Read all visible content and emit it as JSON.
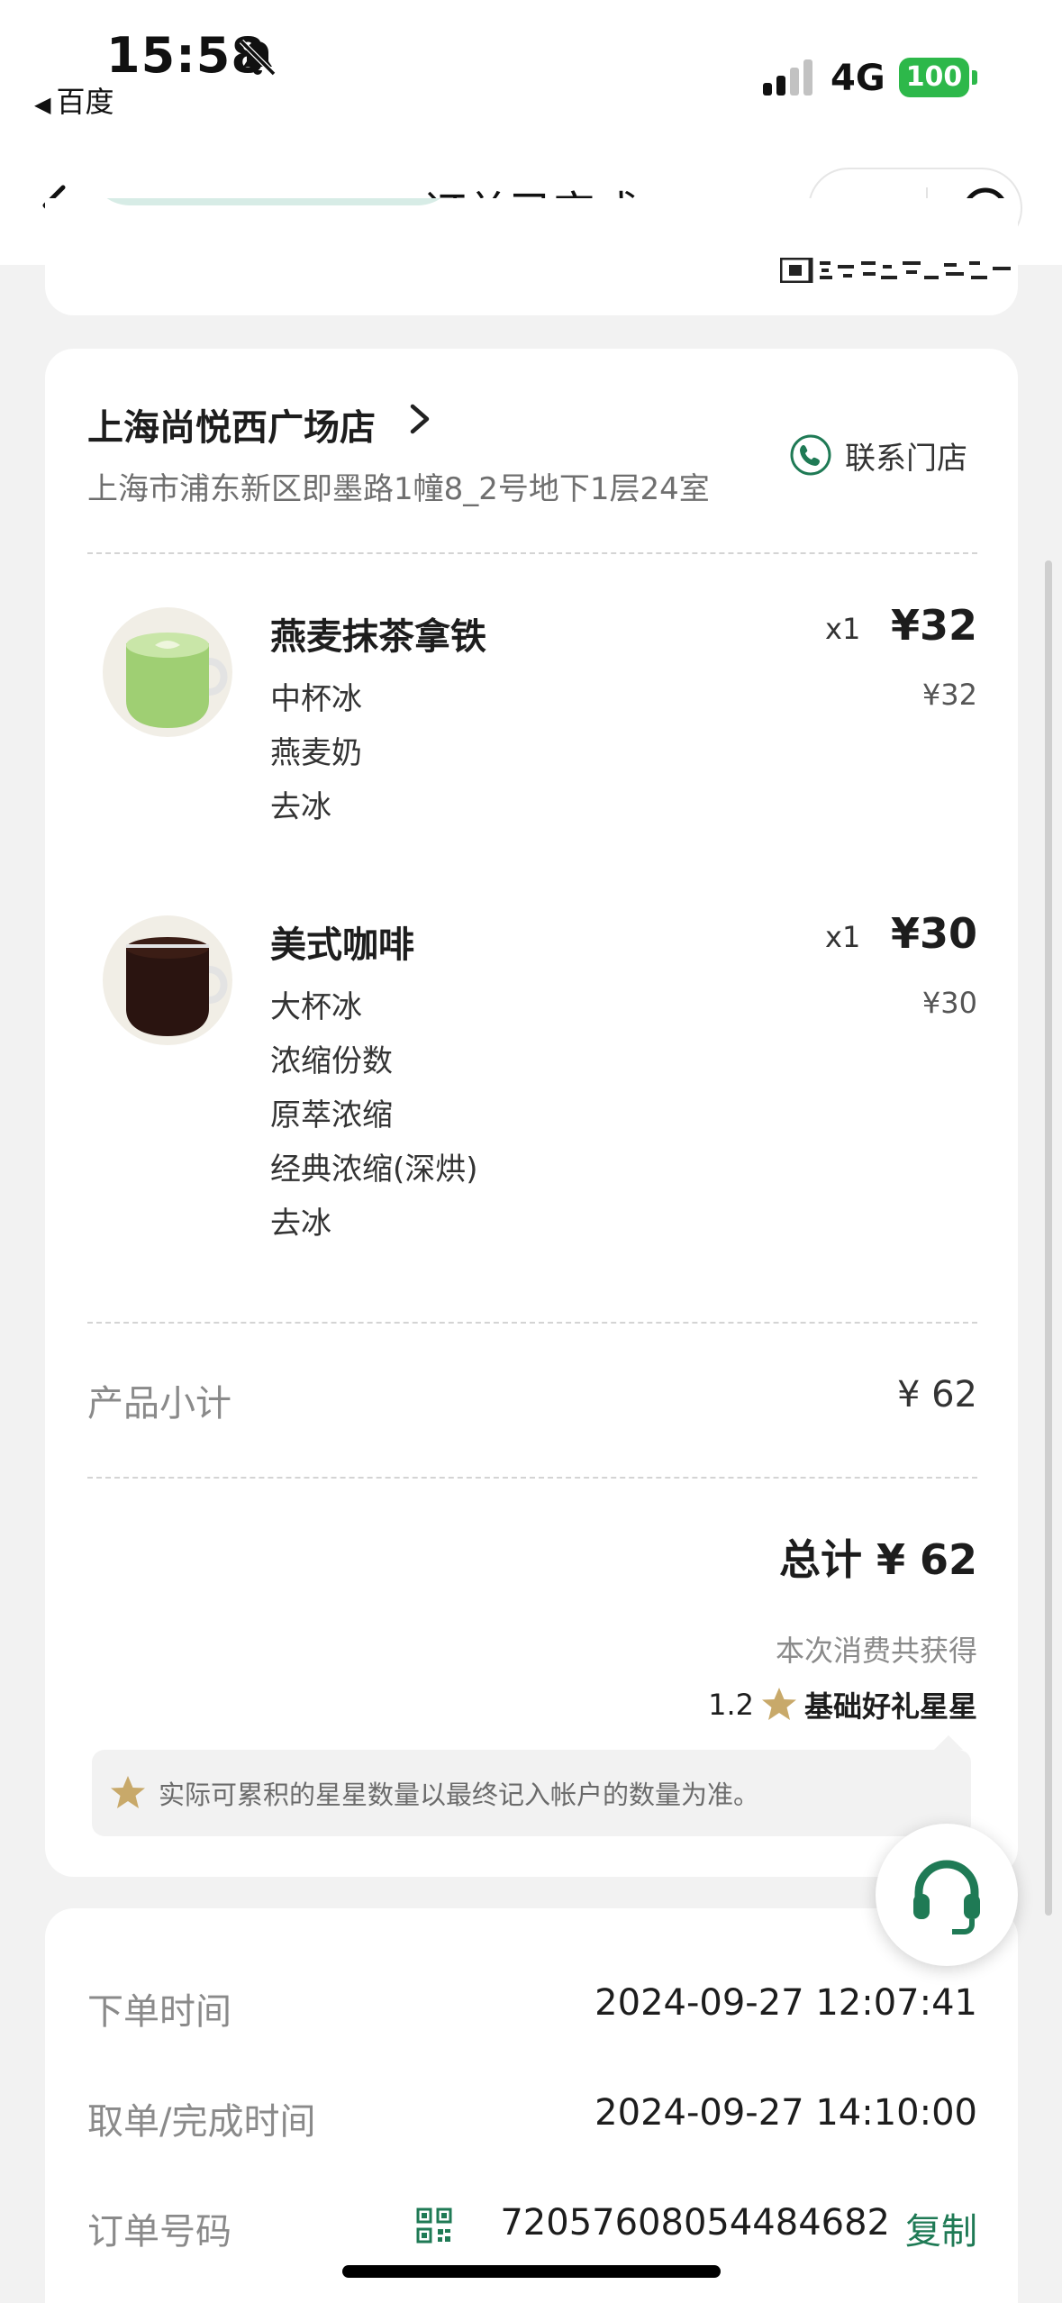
{
  "status_bar": {
    "time": "15:58",
    "back_app": "百度",
    "network": "4G",
    "battery": "100"
  },
  "nav": {
    "title": "订单已完成"
  },
  "store": {
    "name": "上海尚悦西广场店",
    "address": "上海市浦东新区即墨路1幢8_2号地下1层24室",
    "contact_label": "联系门店"
  },
  "items": [
    {
      "name": "燕麦抹茶拿铁",
      "qty": "x1",
      "price": "¥32",
      "unit_price": "¥32",
      "options": [
        "中杯冰",
        "燕麦奶",
        "去冰"
      ]
    },
    {
      "name": "美式咖啡",
      "qty": "x1",
      "price": "¥30",
      "unit_price": "¥30",
      "options": [
        "大杯冰",
        "浓缩份数",
        "原萃浓缩",
        "经典浓缩(深烘)",
        "去冰"
      ]
    }
  ],
  "summary": {
    "subtotal_label": "产品小计",
    "subtotal_value": "¥ 62",
    "total": "总计 ¥ 62",
    "earn_label": "本次消费共获得",
    "stars_count": "1.2",
    "stars_label": "基础好礼星星",
    "notice": "实际可累积的星星数量以最终记入帐户的数量为准。"
  },
  "order_info": {
    "order_time_label": "下单时间",
    "order_time": "2024-09-27 12:07:41",
    "complete_time_label": "取单/完成时间",
    "complete_time": "2024-09-27 14:10:00",
    "order_no_label": "订单号码",
    "order_no": "72057608054484682",
    "copy_label": "复制"
  },
  "colors": {
    "brand_green": "#1f7a55",
    "star_gold": "#c8a96a",
    "battery_green": "#2db84a"
  }
}
